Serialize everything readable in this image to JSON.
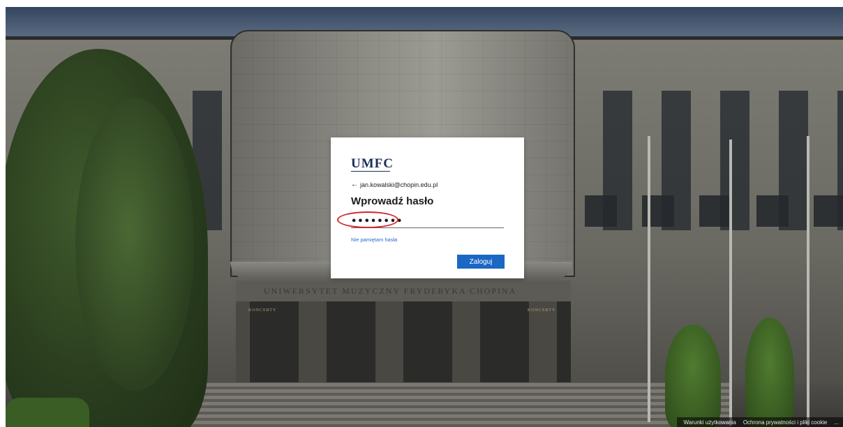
{
  "background": {
    "building_sign": "UNIWERSYTET MUZYCZNY FRYDERYKA CHOPINA",
    "side_sign": "KONCERTY"
  },
  "card": {
    "logo": "UMFC",
    "back_icon": "arrow-left-icon",
    "account_email": "jan.kowalski@chopin.edu.pl",
    "title": "Wprowadź hasło",
    "password_value": "••••••••",
    "forgot_link": "Nie pamiętam hasła",
    "signin_label": "Zaloguj"
  },
  "footer": {
    "terms": "Warunki użytkowania",
    "privacy": "Ochrona prywatności i pliki cookie",
    "more": "..."
  },
  "colors": {
    "accent": "#1a67c4",
    "link": "#2a6bd1",
    "logo": "#1c2d5a",
    "highlight": "#d8242b"
  }
}
